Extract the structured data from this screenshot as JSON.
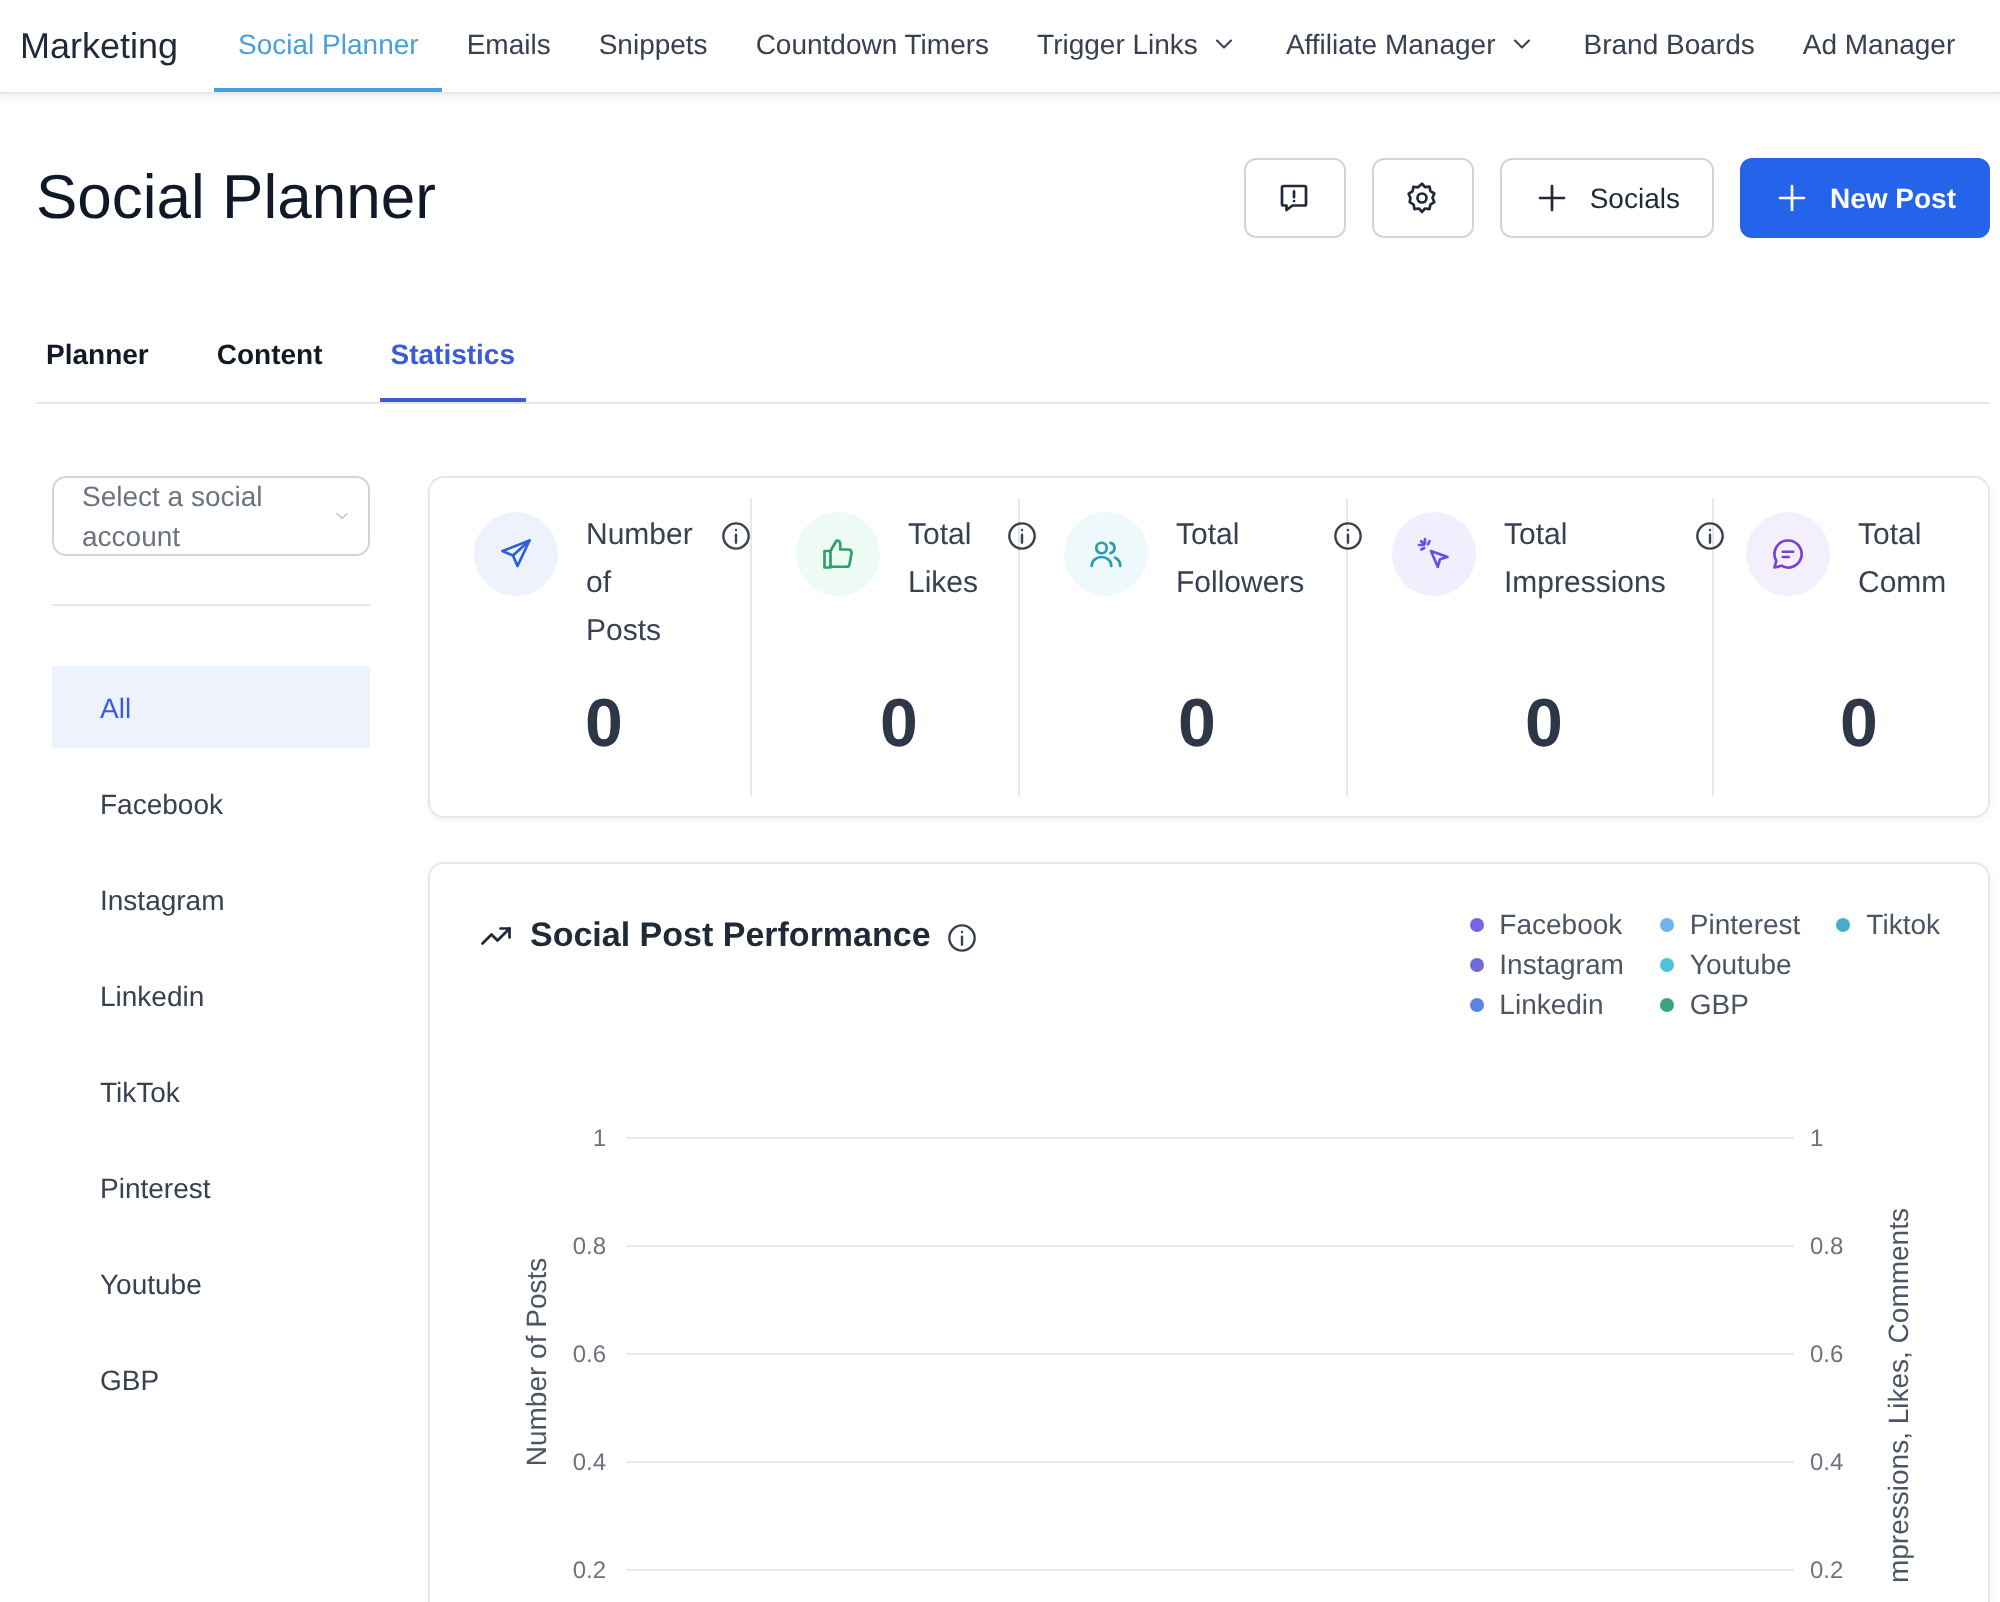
{
  "nav": {
    "brand": "Marketing",
    "items": [
      {
        "label": "Social Planner",
        "selected": true,
        "dropdown": false
      },
      {
        "label": "Emails",
        "selected": false,
        "dropdown": false
      },
      {
        "label": "Snippets",
        "selected": false,
        "dropdown": false
      },
      {
        "label": "Countdown Timers",
        "selected": false,
        "dropdown": false
      },
      {
        "label": "Trigger Links",
        "selected": false,
        "dropdown": true
      },
      {
        "label": "Affiliate Manager",
        "selected": false,
        "dropdown": true
      },
      {
        "label": "Brand Boards",
        "selected": false,
        "dropdown": false
      },
      {
        "label": "Ad Manager",
        "selected": false,
        "dropdown": false
      }
    ]
  },
  "page_title": "Social Planner",
  "header_buttons": [
    {
      "kind": "feedback"
    },
    {
      "kind": "settings"
    },
    {
      "kind": "add",
      "label": "Socials"
    },
    {
      "kind": "primary",
      "label": "New Post"
    }
  ],
  "tabs": [
    {
      "label": "Planner",
      "selected": false
    },
    {
      "label": "Content",
      "selected": false
    },
    {
      "label": "Statistics",
      "selected": true
    }
  ],
  "sidebar": {
    "select": {
      "placeholder": "Select a social account"
    },
    "items": [
      {
        "label": "All",
        "selected": true
      },
      {
        "label": "Facebook",
        "selected": false
      },
      {
        "label": "Instagram",
        "selected": false
      },
      {
        "label": "Linkedin",
        "selected": false
      },
      {
        "label": "TikTok",
        "selected": false
      },
      {
        "label": "Pinterest",
        "selected": false
      },
      {
        "label": "Youtube",
        "selected": false
      },
      {
        "label": "GBP",
        "selected": false
      }
    ]
  },
  "stats": [
    {
      "kind": "posts",
      "label": "Number of Posts",
      "value": "0",
      "info": true
    },
    {
      "kind": "likes",
      "label": "Total Likes",
      "value": "0",
      "info": true
    },
    {
      "kind": "followers",
      "label": "Total Followers",
      "value": "0",
      "info": true
    },
    {
      "kind": "impressions",
      "label": "Total Impressions",
      "value": "0",
      "info": true
    },
    {
      "kind": "comments",
      "label": "Total Comm",
      "value": "0",
      "info": false
    }
  ],
  "performance": {
    "title": "Social Post Performance",
    "chart_data": {
      "type": "line",
      "ylabel": "Number of Posts",
      "y2label": "mpressions, Likes, Comments",
      "ylim": [
        0.2,
        1
      ],
      "y2lim": [
        0.2,
        1
      ],
      "grid": true,
      "yticks": [
        1,
        0.8,
        0.6,
        0.4,
        0.2
      ],
      "y2ticks": [
        1,
        0.8,
        0.6,
        0.4,
        0.2
      ],
      "series": [
        {
          "name": "Facebook",
          "color": "#7b61e8"
        },
        {
          "name": "Instagram",
          "color": "#6f6cd8"
        },
        {
          "name": "Linkedin",
          "color": "#5b83e0"
        },
        {
          "name": "Pinterest",
          "color": "#6cb4ee"
        },
        {
          "name": "Youtube",
          "color": "#4cc3dc"
        },
        {
          "name": "GBP",
          "color": "#3aa57a"
        },
        {
          "name": "Tiktok",
          "color": "#46aec8"
        }
      ]
    }
  }
}
